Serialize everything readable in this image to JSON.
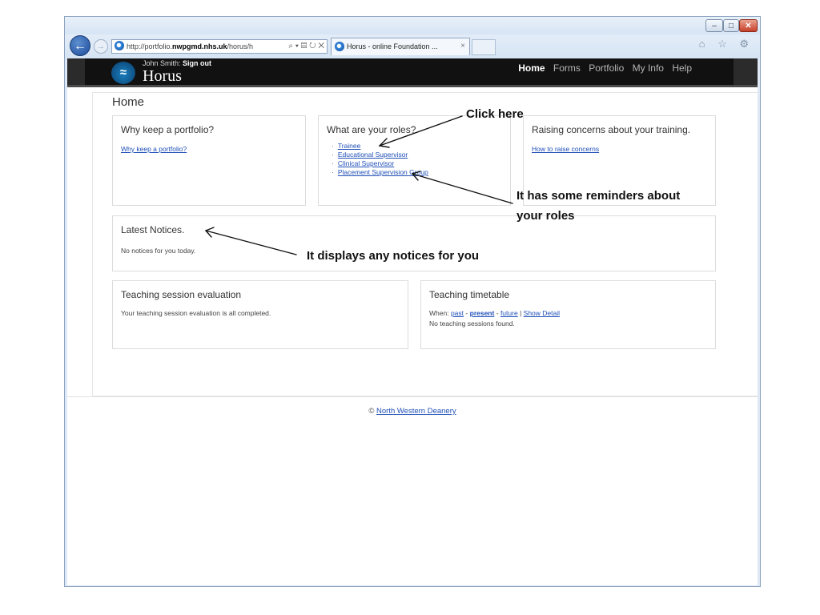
{
  "browser": {
    "url_prefix": "http://portfolio.",
    "url_host": "nwpgmd.nhs.uk",
    "url_suffix": "/horus/h",
    "url_tools": "⌕ ▾ ▤ ↻ ✕",
    "tab_title": "Horus - online Foundation ...",
    "tab_close": "×",
    "toolbar_icons": "⌂ ☆ ⚙",
    "win_min": "‒",
    "win_max": "□",
    "win_close": "✕",
    "back_arrow": "←",
    "forward_arrow": "→"
  },
  "site": {
    "user_name": "John Smith:",
    "sign_out": "Sign out",
    "brand": "Horus",
    "logo_icon": "horus-eye-logo",
    "nav": [
      "Home",
      "Forms",
      "Portfolio",
      "My Info",
      "Help"
    ]
  },
  "page_title": "Home",
  "cards": {
    "why": {
      "title": "Why keep a portfolio?",
      "link": "Why keep a portfolio?"
    },
    "roles": {
      "title": "What are your roles?",
      "items": [
        "Trainee",
        "Educational Supervisor",
        "Clinical Supervisor",
        "Placement Supervision Group"
      ]
    },
    "concerns": {
      "title": "Raising concerns about your training.",
      "link": "How to raise concerns"
    },
    "notices": {
      "title": "Latest Notices.",
      "text": "No notices for you today."
    },
    "evaluation": {
      "title": "Teaching session evaluation",
      "text": "Your teaching session evaluation is all completed."
    },
    "timetable": {
      "title": "Teaching timetable",
      "when_label": "When:",
      "past": "past",
      "sep1": "-",
      "present": "present",
      "sep2": "-",
      "future": "future",
      "sep3": "|",
      "show_detail": "Show Detail",
      "empty": "No teaching sessions found."
    }
  },
  "footer": {
    "copyright": "©",
    "org": "North Western Deanery"
  },
  "annotations": {
    "click_here": "Click here",
    "reminders_line1": "It has some reminders about",
    "reminders_line2": "your roles",
    "notices": "It displays any notices for you"
  }
}
